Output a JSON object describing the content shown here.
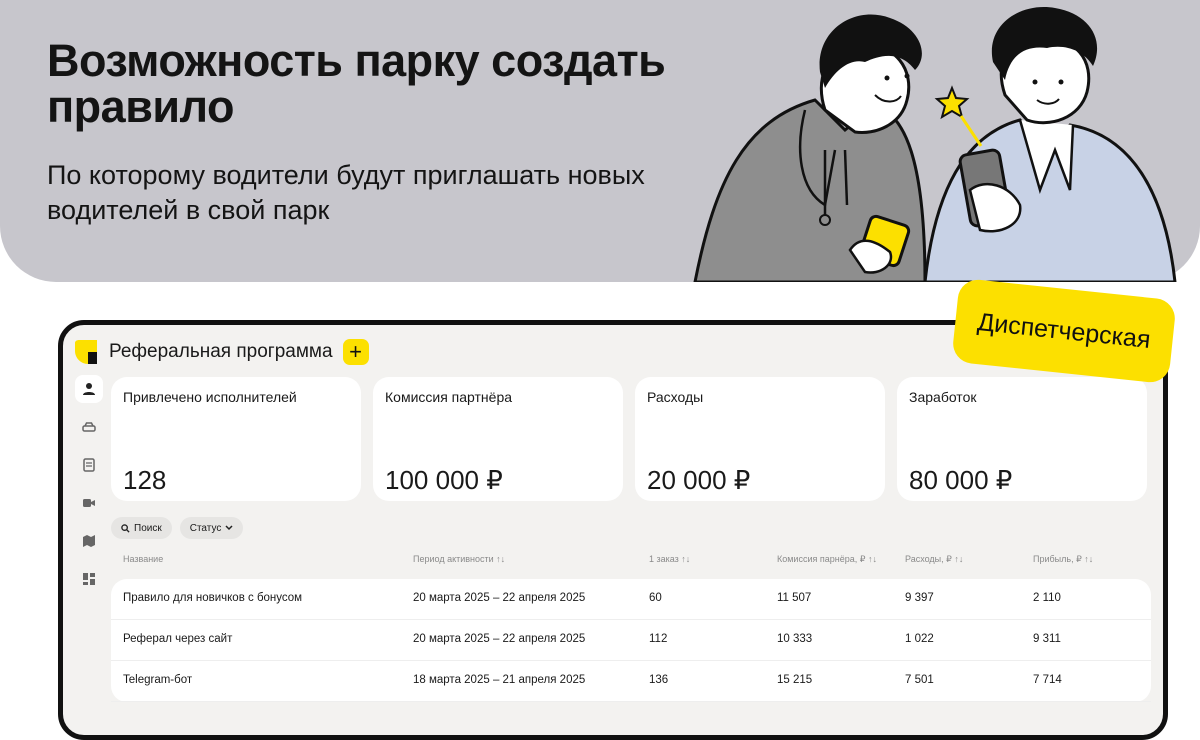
{
  "hero": {
    "title": "Возможность парку создать правило",
    "subtitle": "По которому водители будут приглашать новых водителей в свой парк"
  },
  "badge": {
    "label": "Диспетчерская"
  },
  "app": {
    "title": "Реферальная программа",
    "add_label": "+",
    "accent_color": "#fce000"
  },
  "sidebar": {
    "items": [
      {
        "icon": "user-icon",
        "active": true
      },
      {
        "icon": "car-icon"
      },
      {
        "icon": "document-icon"
      },
      {
        "icon": "video-icon"
      },
      {
        "icon": "map-icon"
      },
      {
        "icon": "dashboard-icon"
      }
    ]
  },
  "stats": [
    {
      "label": "Привлечено исполнителей",
      "value": "128"
    },
    {
      "label": "Комиссия партнёра",
      "value": "100 000 ₽"
    },
    {
      "label": "Расходы",
      "value": "20 000 ₽"
    },
    {
      "label": "Заработок",
      "value": "80 000 ₽"
    }
  ],
  "filters": {
    "search_label": "Поиск",
    "status_label": "Статус"
  },
  "table": {
    "headers": [
      "Название",
      "Период активности ↑↓",
      "1 заказ ↑↓",
      "Комиссия парнёра, ₽ ↑↓",
      "Расходы, ₽ ↑↓",
      "Прибыль, ₽ ↑↓"
    ],
    "rows": [
      [
        "Правило для новичков с бонусом",
        "20 марта 2025 – 22 апреля 2025",
        "60",
        "11 507",
        "9 397",
        "2 110"
      ],
      [
        "Реферал через сайт",
        "20 марта 2025 – 22 апреля 2025",
        "112",
        "10 333",
        "1 022",
        "9 311"
      ],
      [
        "Telegram-бот",
        "18 марта 2025 – 21 апреля 2025",
        "136",
        "15 215",
        "7 501",
        "7 714"
      ]
    ]
  }
}
